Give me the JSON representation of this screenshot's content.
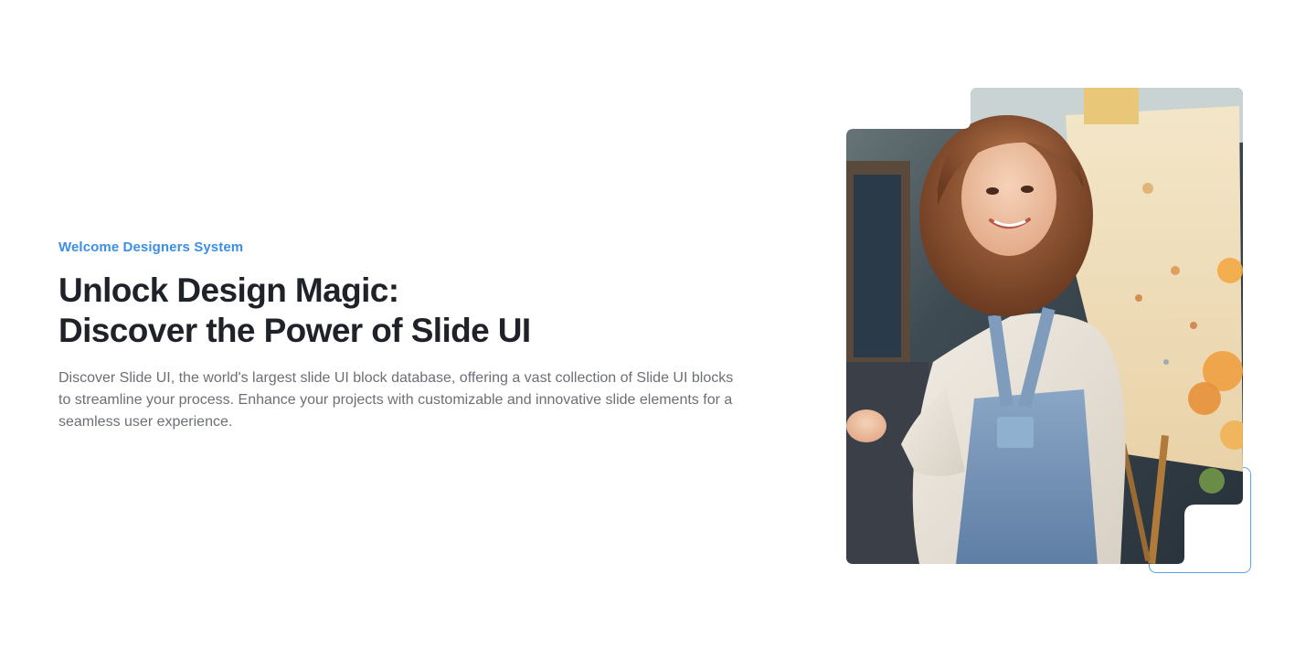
{
  "hero": {
    "eyebrow": "Welcome Designers System",
    "headline_line1": "Unlock Design Magic:",
    "headline_line2": "Discover the Power of Slide UI",
    "description": "Discover Slide UI, the world's largest slide UI block database, offering a vast collection of Slide UI blocks to streamline your process. Enhance your projects with customizable and innovative slide elements for a seamless user experience."
  },
  "colors": {
    "accent": "#3b8fe6",
    "heading": "#1f2329",
    "body": "#6b6f76",
    "frame": "#5aa2ec"
  },
  "media": {
    "image_alt": "Illustration of a smiling woman painting at an easel"
  }
}
